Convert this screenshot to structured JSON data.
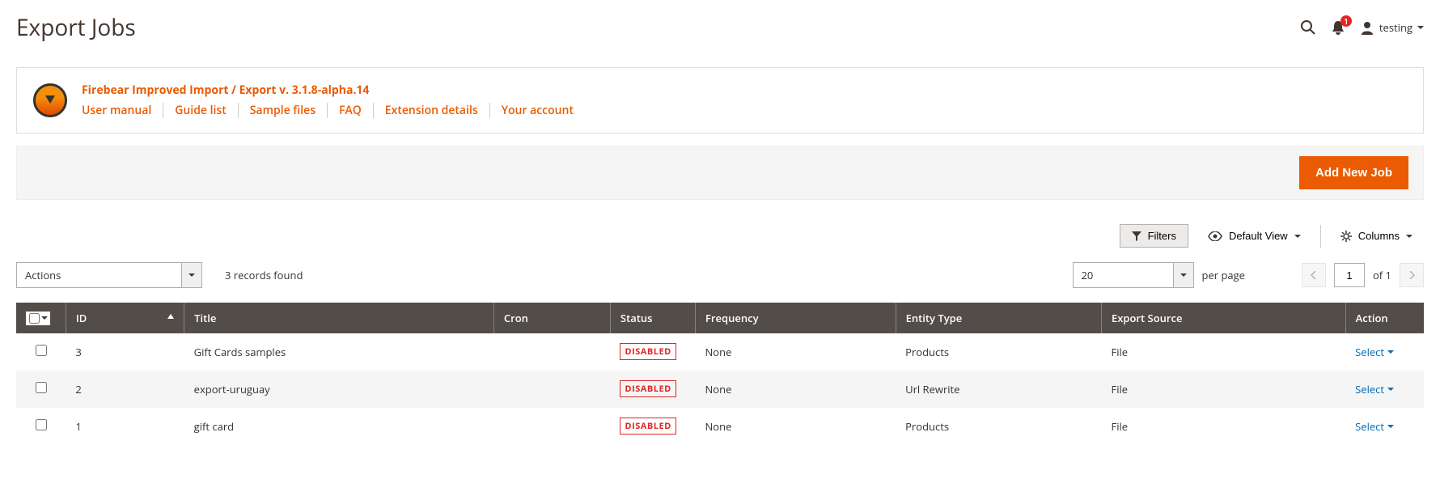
{
  "header": {
    "title": "Export Jobs",
    "notifications": "1",
    "user": "testing"
  },
  "banner": {
    "title": "Firebear Improved Import / Export v. 3.1.8-alpha.14",
    "links": {
      "user_manual": "User manual",
      "guide_list": "Guide list",
      "sample_files": "Sample files",
      "faq": "FAQ",
      "extension_details": "Extension details",
      "your_account": "Your account"
    }
  },
  "actions": {
    "add_new": "Add New Job",
    "filters": "Filters",
    "default_view": "Default View",
    "columns": "Columns",
    "actions_select": "Actions",
    "records_found": "3 records found",
    "per_page_value": "20",
    "per_page_label": "per page",
    "page_current": "1",
    "page_total": "of 1"
  },
  "columns": {
    "id": "ID",
    "title": "Title",
    "cron": "Cron",
    "status": "Status",
    "frequency": "Frequency",
    "entity_type": "Entity Type",
    "export_source": "Export Source",
    "action": "Action"
  },
  "status_labels": {
    "disabled": "DISABLED"
  },
  "row_action": "Select",
  "rows": [
    {
      "id": "3",
      "title": "Gift Cards samples",
      "cron": "",
      "status": "disabled",
      "frequency": "None",
      "entity_type": "Products",
      "export_source": "File"
    },
    {
      "id": "2",
      "title": "export-uruguay",
      "cron": "",
      "status": "disabled",
      "frequency": "None",
      "entity_type": "Url Rewrite",
      "export_source": "File"
    },
    {
      "id": "1",
      "title": "gift card",
      "cron": "",
      "status": "disabled",
      "frequency": "None",
      "entity_type": "Products",
      "export_source": "File"
    }
  ]
}
